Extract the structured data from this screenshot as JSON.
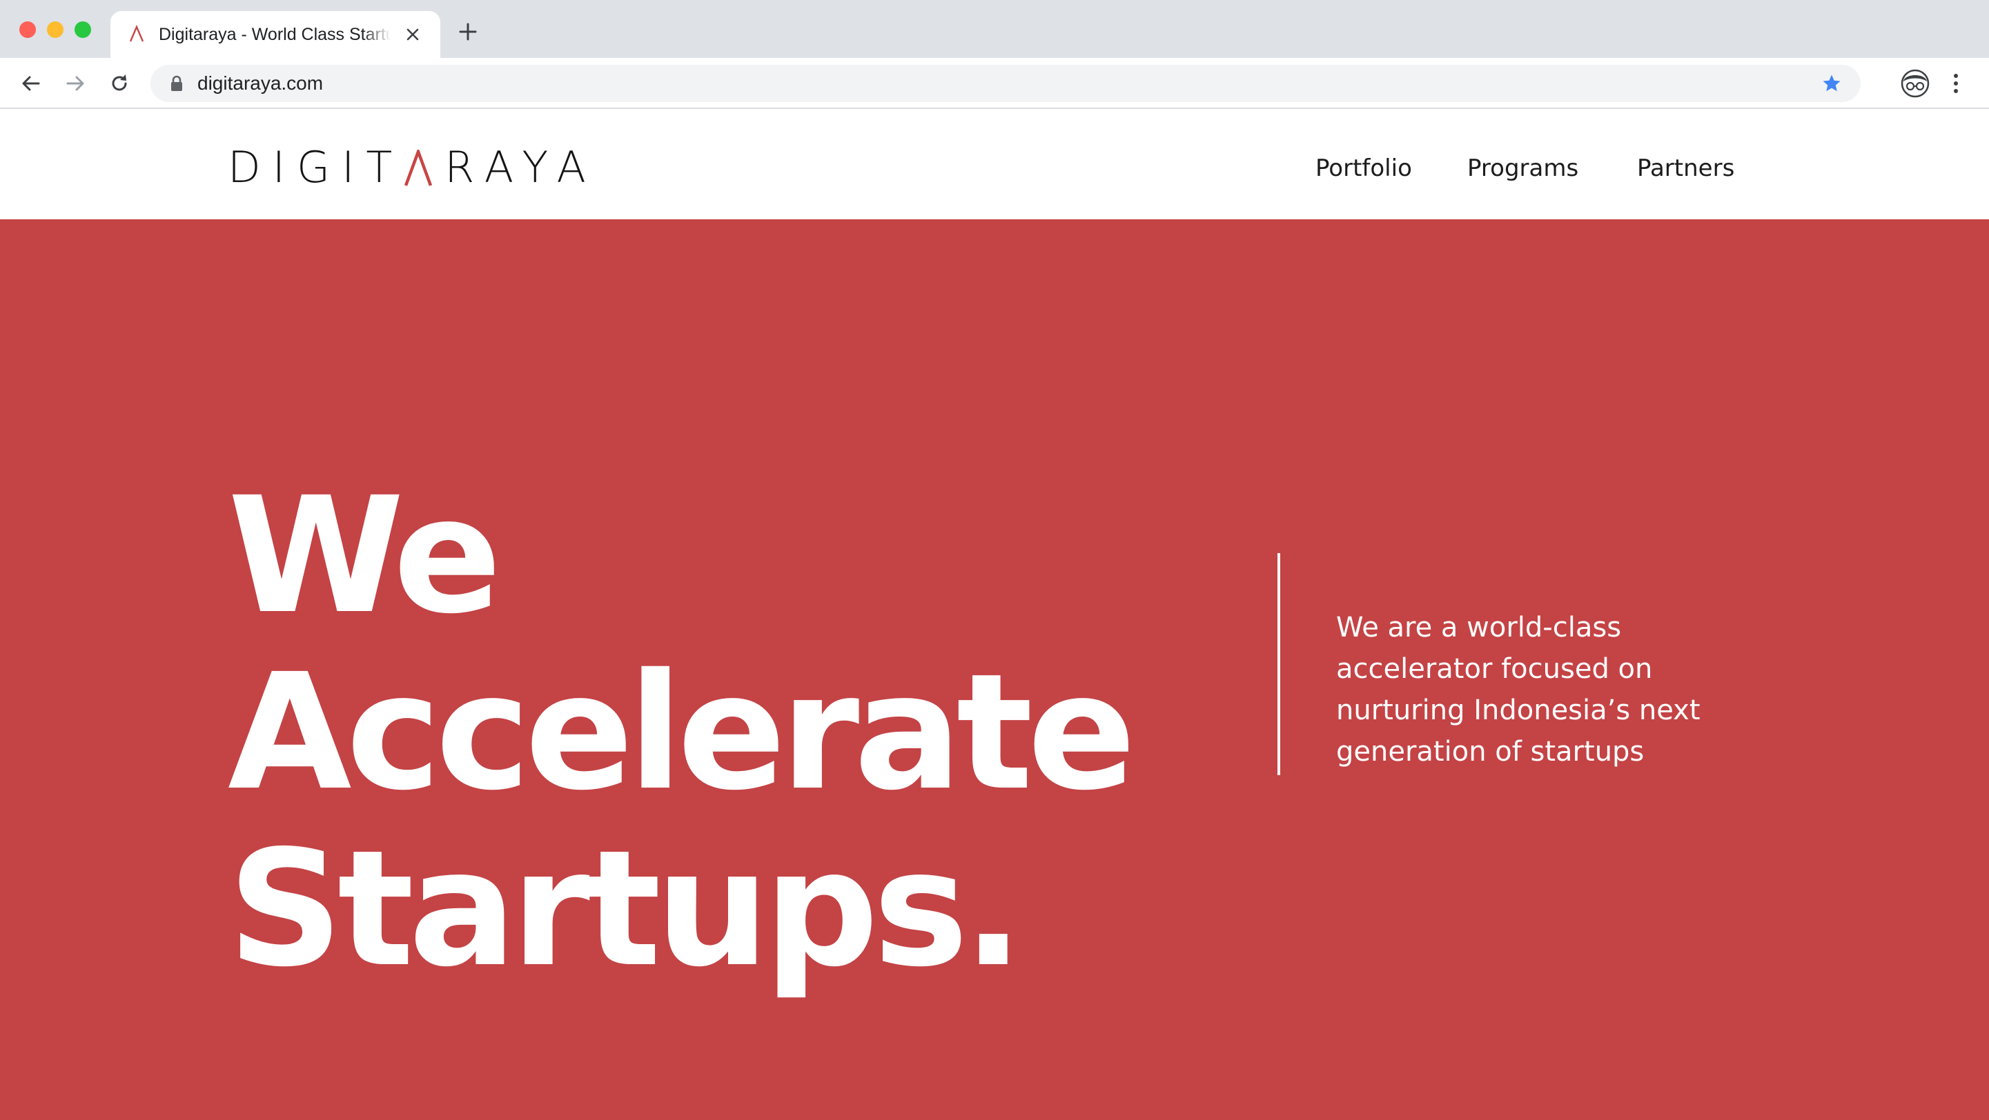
{
  "browser": {
    "tab": {
      "title": "Digitaraya - World Class Startup Accelerator",
      "favicon": "digitaraya-favicon-icon"
    },
    "new_tab_icon": "plus-icon",
    "address_bar": {
      "url": "digitaraya.com",
      "secure_icon": "lock-icon",
      "bookmarked": true
    },
    "colors": {
      "star": "#4285f4"
    }
  },
  "site": {
    "logo": {
      "before": "DIGIT",
      "after": "RAYA"
    },
    "nav": {
      "items": [
        "Portfolio",
        "Programs",
        "Partners"
      ]
    },
    "hero": {
      "headline": [
        "We",
        "Accelerate",
        "Startups."
      ],
      "tagline": [
        "We are a world-class",
        "accelerator focused on",
        "nurturing Indonesia’s next",
        "generation of startups"
      ]
    },
    "colors": {
      "brand_red": "#c44345",
      "text_dark": "#141414",
      "hero_text": "#ffffff"
    }
  }
}
